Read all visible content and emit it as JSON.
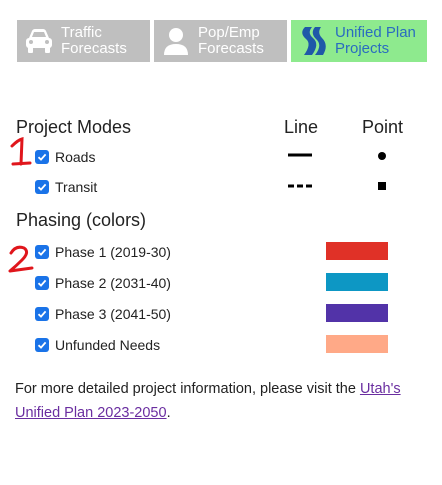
{
  "tabs": [
    {
      "label": "Traffic\nForecasts",
      "icon": "car-icon",
      "active": false
    },
    {
      "label": "Pop/Emp\nForecasts",
      "icon": "person-icon",
      "active": false
    },
    {
      "label": "Unified Plan\nProjects",
      "icon": "road-icon",
      "active": true
    }
  ],
  "modes": {
    "title": "Project Modes",
    "col_line": "Line",
    "col_point": "Point",
    "items": [
      {
        "label": "Roads",
        "checked": true,
        "line_style": "solid",
        "point_style": "circle"
      },
      {
        "label": "Transit",
        "checked": true,
        "line_style": "dashed",
        "point_style": "square"
      }
    ]
  },
  "phasing": {
    "title": "Phasing (colors)",
    "items": [
      {
        "label": "Phase 1 (2019-30)",
        "checked": true,
        "color": "#e03127"
      },
      {
        "label": "Phase 2 (2031-40)",
        "checked": true,
        "color": "#0d97c4"
      },
      {
        "label": "Phase 3 (2041-50)",
        "checked": true,
        "color": "#5233a8"
      },
      {
        "label": "Unfunded Needs",
        "checked": true,
        "color": "#ffa987"
      }
    ]
  },
  "footer": {
    "text": "For more detailed project information, please visit the ",
    "link": "Utah's Unified Plan 2023-2050",
    "end": "."
  },
  "annotations": {
    "one": "1",
    "two": "2"
  },
  "colors": {
    "accent": "#1a73e8",
    "annotation": "#e0161c",
    "active_tab": "#8eea8e",
    "inactive_tab": "#bfbfbf"
  }
}
